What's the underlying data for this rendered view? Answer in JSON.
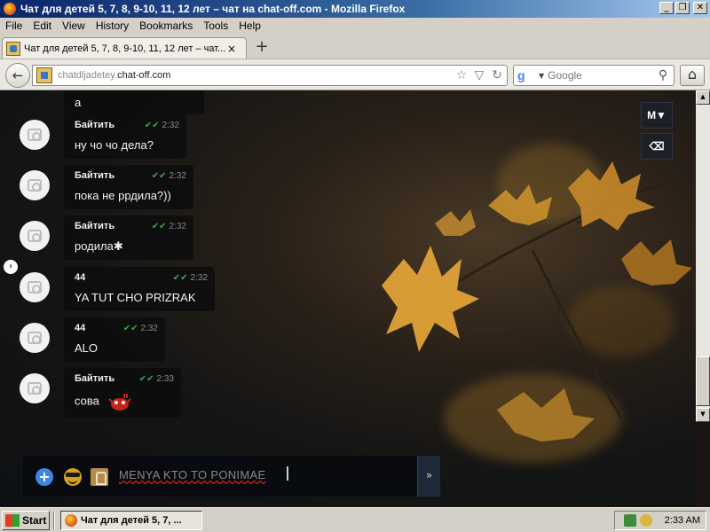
{
  "window": {
    "title": "Чат для детей 5, 7, 8, 9-10, 11, 12 лет – чат на chat-off.com - Mozilla Firefox",
    "buttons": {
      "minimize": "_",
      "maximize": "❐",
      "close": "✕"
    }
  },
  "menu": [
    "File",
    "Edit",
    "View",
    "History",
    "Bookmarks",
    "Tools",
    "Help"
  ],
  "tab": {
    "title": "Чат для детей 5, 7, 8, 9-10, 11, 12 лет – чат...",
    "close": "×",
    "new_tab": "+"
  },
  "nav": {
    "back": "←",
    "url_prefix": "chatdljadetey.",
    "url_domain": "chat-off.com",
    "search_placeholder": "Google",
    "home": "⌂"
  },
  "chat": {
    "partial_message": "а",
    "messages": [
      {
        "name": "Байтить",
        "time": "2:32",
        "text": "ну чо чо дела?"
      },
      {
        "name": "Байтить",
        "time": "2:32",
        "text": "пока не ррдила?))"
      },
      {
        "name": "Байтить",
        "time": "2:32",
        "text": "родила✱"
      },
      {
        "name": "44",
        "time": "2:32",
        "text": "YA TUT CHO PRIZRAK"
      },
      {
        "name": "44",
        "time": "2:32",
        "text": "ALO"
      },
      {
        "name": "Байтить",
        "time": "2:33",
        "text": "сова"
      }
    ],
    "read_mark": "✔✔",
    "side_buttons": {
      "m": "M▼",
      "eraser": "⌫"
    },
    "expander": "›"
  },
  "composer": {
    "text_plain": "MENYA KTO TO PONIMAE",
    "send": "»",
    "plus": "+"
  },
  "taskbar": {
    "start": "Start",
    "item": "Чат для детей 5, 7, ...",
    "clock": "2:33 AM"
  },
  "colors": {
    "check": "#3aa84a",
    "accent_blue": "#3f86e8",
    "titlebar": "#0a246a"
  }
}
